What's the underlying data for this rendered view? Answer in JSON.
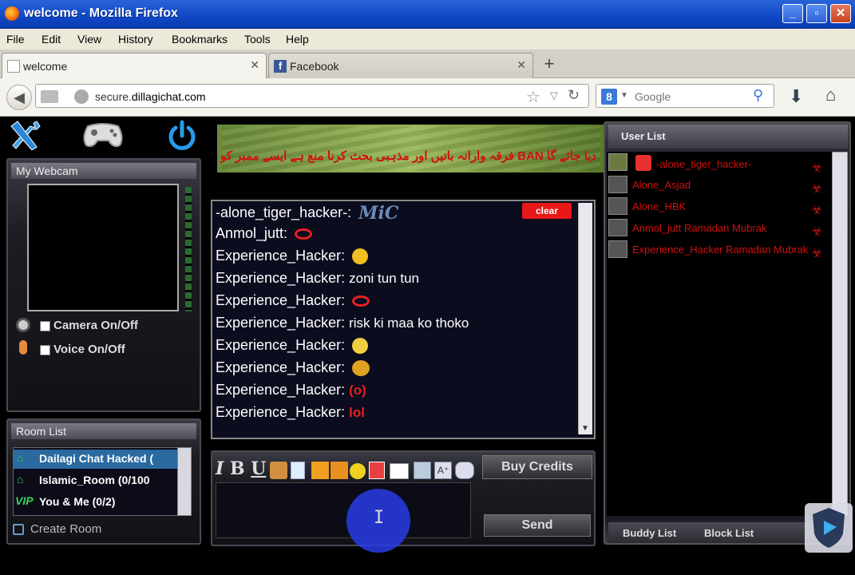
{
  "browser": {
    "window_title": "welcome - Mozilla Firefox",
    "menu": [
      "File",
      "Edit",
      "View",
      "History",
      "Bookmarks",
      "Tools",
      "Help"
    ],
    "tabs": [
      {
        "label": "welcome",
        "active": true
      },
      {
        "label": "Facebook",
        "active": false
      }
    ],
    "new_tab_label": "+",
    "url_prefix": "secure.",
    "url_domain": "dillagichat.com",
    "search_placeholder": "Google",
    "search_engine_letter": "8"
  },
  "app": {
    "banner_text": "فرقہ وارانہ باتیں اور مذہبی بحث کرنا منع ہے ایسے ممبر کو BAN کر دیا جائے گا",
    "webcam": {
      "title": "My Webcam",
      "camera_label": "Camera On/Off",
      "voice_label": "Voice On/Off"
    },
    "room_list": {
      "title": "Room List",
      "rooms": [
        {
          "name": "Dailagi Chat Hacked (",
          "icon": "home-icon"
        },
        {
          "name": "Islamic_Room (0/100",
          "icon": "home-icon"
        },
        {
          "name": "You & Me (0/2)",
          "icon": "vip-icon"
        }
      ],
      "create_room_label": "Create Room"
    },
    "chat": {
      "clear_label": "clear",
      "messages": [
        {
          "user": "-alone_tiger_hacker-:",
          "text": "",
          "emoticon": "mic-logo-icon"
        },
        {
          "user": "Anmol_jutt:",
          "text": "",
          "emoticon": "lips-icon"
        },
        {
          "user": "Experience_Hacker:",
          "text": "",
          "emoticon": "rocket-smiley-icon"
        },
        {
          "user": "Experience_Hacker:",
          "text": "zoni tun tun",
          "emoticon": ""
        },
        {
          "user": "Experience_Hacker:",
          "text": "",
          "emoticon": "lips-icon"
        },
        {
          "user": "Experience_Hacker:",
          "text": "risk ki maa ko thoko",
          "emoticon": ""
        },
        {
          "user": "Experience_Hacker:",
          "text": "",
          "emoticon": "smiley-icon"
        },
        {
          "user": "Experience_Hacker:",
          "text": "",
          "emoticon": "angry-smiley-icon"
        },
        {
          "user": "Experience_Hacker:",
          "text": "(o)",
          "emoticon": ""
        },
        {
          "user": "Experience_Hacker:",
          "text": "lol",
          "emoticon": ""
        }
      ]
    },
    "composer": {
      "format_buttons": [
        "I",
        "B",
        "U"
      ],
      "buy_credits_label": "Buy Credits",
      "send_label": "Send"
    },
    "user_list": {
      "title": "User List",
      "users": [
        "-alone_tiger_hacker-",
        "Alone_Asjad",
        "Alone_HBK",
        "Anmol_jutt Ramadan Mubrak",
        "Experience_Hacker Ramadan Mubrak"
      ],
      "buddy_list_label": "Buddy List",
      "block_list_label": "Block List"
    },
    "colors": {
      "username_red": "#d01010",
      "titlebar_blue": "#0f47c6"
    }
  }
}
